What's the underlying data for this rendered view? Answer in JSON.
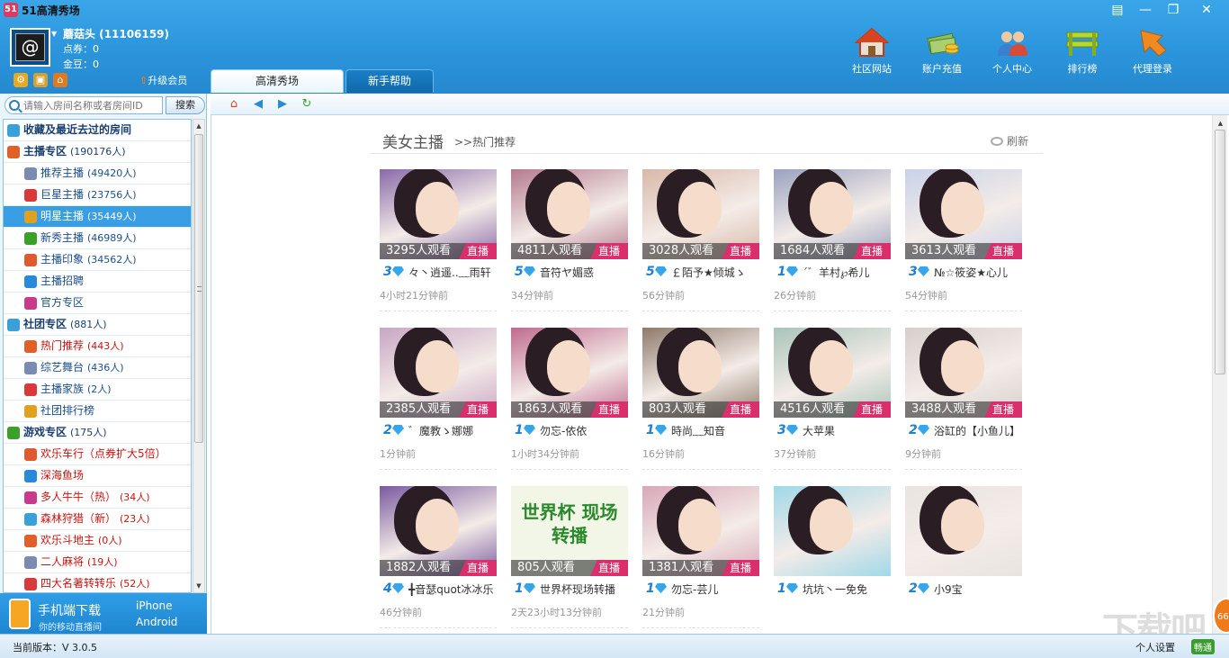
{
  "window": {
    "title": "51高清秀场"
  },
  "user": {
    "name": "蘑菇头 (11106159)",
    "points": "点券：0",
    "gold": "金豆：0",
    "upgrade": "升级会员"
  },
  "nav": [
    {
      "label": "社区网站",
      "icon": "house-icon"
    },
    {
      "label": "账户充值",
      "icon": "money-icon"
    },
    {
      "label": "个人中心",
      "icon": "users-icon"
    },
    {
      "label": "排行榜",
      "icon": "podium-icon"
    },
    {
      "label": "代理登录",
      "icon": "arrow-down-icon"
    }
  ],
  "tabs": {
    "active": "高清秀场",
    "other": "新手帮助"
  },
  "search": {
    "placeholder": "请输入房间名称或者房间ID",
    "button": "搜索"
  },
  "sidebar": {
    "items": [
      {
        "label": "收藏及最近去过的房间",
        "count": "",
        "type": "cat"
      },
      {
        "label": "主播专区",
        "count": "(190176人)",
        "type": "cat"
      },
      {
        "label": "推荐主播",
        "count": "(49420人)",
        "type": "sub"
      },
      {
        "label": "巨星主播",
        "count": "(23756人)",
        "type": "sub"
      },
      {
        "label": "明星主播",
        "count": "(35449人)",
        "type": "sub",
        "selected": true
      },
      {
        "label": "新秀主播",
        "count": "(46989人)",
        "type": "sub"
      },
      {
        "label": "主播印象",
        "count": "(34562人)",
        "type": "sub"
      },
      {
        "label": "主播招聘",
        "count": "",
        "type": "sub"
      },
      {
        "label": "官方专区",
        "count": "",
        "type": "sub"
      },
      {
        "label": "社团专区",
        "count": "(881人)",
        "type": "cat"
      },
      {
        "label": "热门推荐",
        "count": "(443人)",
        "type": "sub",
        "red": true
      },
      {
        "label": "综艺舞台",
        "count": "(436人)",
        "type": "sub"
      },
      {
        "label": "主播家族",
        "count": "(2人)",
        "type": "sub"
      },
      {
        "label": "社团排行榜",
        "count": "",
        "type": "sub"
      },
      {
        "label": "游戏专区",
        "count": "(175人)",
        "type": "cat"
      },
      {
        "label": "欢乐车行（点券扩大5倍）",
        "count": "",
        "type": "sub",
        "red": true
      },
      {
        "label": "深海鱼场",
        "count": "",
        "type": "sub",
        "red": true
      },
      {
        "label": "多人牛牛（热）",
        "count": "(34人)",
        "type": "sub",
        "red": true
      },
      {
        "label": "森林狩猎（新）",
        "count": "(23人)",
        "type": "sub",
        "red": true
      },
      {
        "label": "欢乐斗地主",
        "count": "(0人)",
        "type": "sub",
        "red": true
      },
      {
        "label": "二人麻将",
        "count": "(19人)",
        "type": "sub",
        "red": true
      },
      {
        "label": "四大名著转转乐",
        "count": "(52人)",
        "type": "sub",
        "red": true
      }
    ]
  },
  "mobile": {
    "title": "手机端下载",
    "subtitle": "你的移动直播间",
    "ios": "iPhone",
    "android": "Android"
  },
  "section": {
    "title": "美女主播",
    "subtitle": ">>热门推荐",
    "refresh": "刷新"
  },
  "live_label": "直播",
  "cards": [
    {
      "viewers": "3295人观看",
      "level": "3",
      "name": "々丶逍遥..﹏雨轩",
      "time": "4小时21分钟前",
      "color": "#8a6aa8"
    },
    {
      "viewers": "4811人观看",
      "level": "5",
      "name": "音符ヤ媚惑",
      "time": "34分钟前",
      "color": "#b47a8e"
    },
    {
      "viewers": "3028人观看",
      "level": "5",
      "name": "￡陌予★倾城ゝ",
      "time": "56分钟前",
      "color": "#d8b8a8"
    },
    {
      "viewers": "1684人观看",
      "level": "1",
      "name": "ˊ゛羊村℘希儿",
      "time": "26分钟前",
      "color": "#9aa2c0"
    },
    {
      "viewers": "3613人观看",
      "level": "3",
      "name": "№☆筱姿★心儿",
      "time": "54分钟前",
      "color": "#c8d2e8"
    },
    {
      "viewers": "2385人观看",
      "level": "2",
      "name": "゛魔教ゝ娜娜",
      "time": "1分钟前",
      "color": "#c8a6c4"
    },
    {
      "viewers": "1863人观看",
      "level": "1",
      "name": "勿忘-依依",
      "time": "1小时34分钟前",
      "color": "#c06a90"
    },
    {
      "viewers": "803人观看",
      "level": "1",
      "name": "時尚﹏知音",
      "time": "16分钟前",
      "color": "#8e7a6a"
    },
    {
      "viewers": "4516人观看",
      "level": "3",
      "name": "大苹果",
      "time": "37分钟前",
      "color": "#a8c4b8"
    },
    {
      "viewers": "3488人观看",
      "level": "2",
      "name": "浴缸的【小鱼儿】",
      "time": "9分钟前",
      "color": "#d6cfcc"
    },
    {
      "viewers": "1882人观看",
      "level": "4",
      "name": "╋音瑟quot冰冰乐",
      "time": "46分钟前",
      "color": "#7a5aa0"
    },
    {
      "viewers": "805人观看",
      "level": "1",
      "name": "世界杯现场转播",
      "time": "2天23小时13分钟前",
      "color": "#f2f6e6",
      "special": "世界杯 现场转播"
    },
    {
      "viewers": "1381人观看",
      "level": "1",
      "name": "勿忘-芸儿",
      "time": "21分钟前",
      "color": "#d8a8b8"
    },
    {
      "viewers": "",
      "level": "1",
      "name": "坑坑丶一免免",
      "time": "",
      "color": "#a0d8e8"
    },
    {
      "viewers": "",
      "level": "2",
      "name": "小9宝",
      "time": "",
      "color": "#e8e4e0"
    }
  ],
  "status": {
    "version": "当前版本：V 3.0.5",
    "settings": "个人设置",
    "network": "畅通"
  }
}
